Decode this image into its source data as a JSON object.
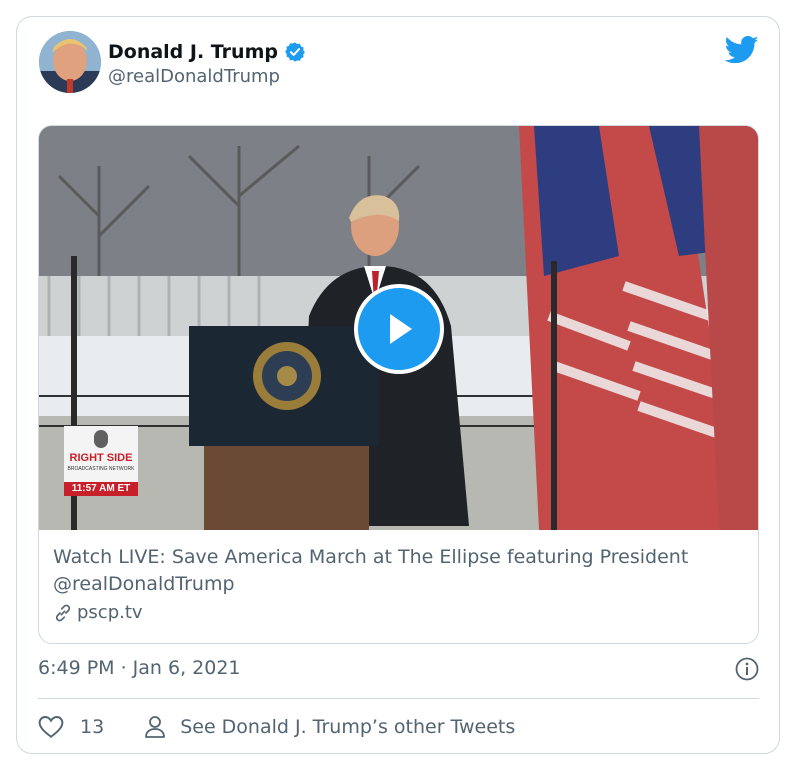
{
  "tweet": {
    "author_name": "Donald J. Trump",
    "handle": "@realDonaldTrump",
    "timestamp": "6:49 PM · Jan 6, 2021",
    "likes": "13",
    "other_tweets_label": "See Donald J. Trump’s other Tweets"
  },
  "link_card": {
    "title": "Watch LIVE: Save America March at The Ellipse featuring President @realDonaldTrump",
    "domain": "pscp.tv"
  },
  "video_overlay": {
    "network_line1": "RIGHT SIDE",
    "network_line2": "BROADCASTING NETWORK",
    "time": "11:57 AM ET"
  },
  "colors": {
    "twitter_blue": "#1d9bf0",
    "secondary_text": "#536471",
    "border": "#cfd9de"
  },
  "icons": [
    "verified-badge-icon",
    "twitter-bird-icon",
    "play-icon",
    "link-icon",
    "info-icon",
    "heart-icon",
    "person-icon"
  ]
}
